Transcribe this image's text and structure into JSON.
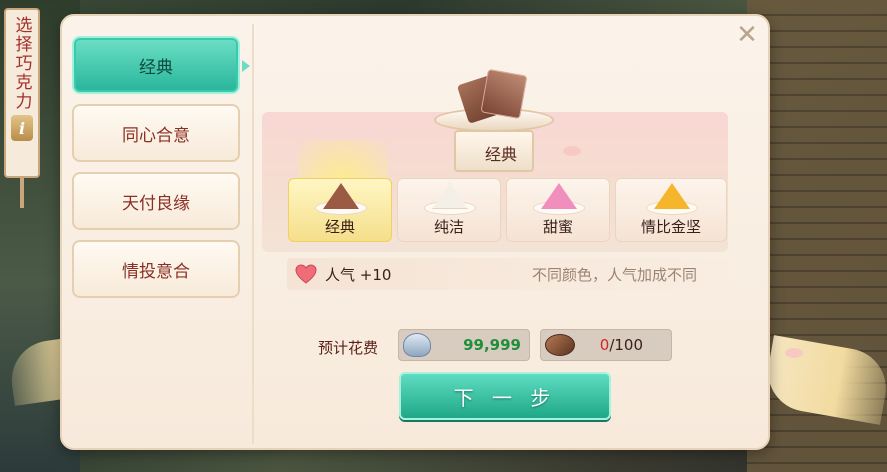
{
  "side_banner": {
    "title": "选择巧克力",
    "info": "i"
  },
  "tabs": [
    {
      "label": "经典",
      "active": true
    },
    {
      "label": "同心合意",
      "active": false
    },
    {
      "label": "天付良缘",
      "active": false
    },
    {
      "label": "情投意合",
      "active": false
    }
  ],
  "preview": {
    "label": "经典"
  },
  "flavors": [
    {
      "label": "经典",
      "selected": true,
      "color": "#9b5a44"
    },
    {
      "label": "纯洁",
      "selected": false,
      "color": "#f4efe7"
    },
    {
      "label": "甜蜜",
      "selected": false,
      "color": "#f08fbd"
    },
    {
      "label": "情比金坚",
      "selected": false,
      "color": "#f6b62c"
    }
  ],
  "info": {
    "popularity": "人气 +10",
    "hint": "不同颜色，人气加成不同"
  },
  "cost": {
    "label": "预计花费",
    "silver": "99,999",
    "bean_current": "0",
    "bean_max": "/100"
  },
  "next_button": "下 一 步",
  "close": "✕",
  "colors": {
    "accent": "#27b59a",
    "tab_text": "#8a2f25",
    "silver_value": "#1f8f3a",
    "bean_current": "#d6261f"
  }
}
